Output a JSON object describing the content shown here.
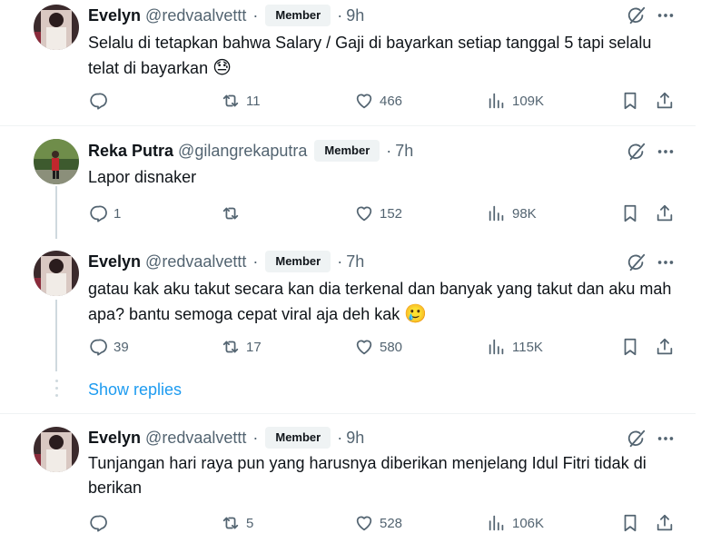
{
  "tweets": [
    {
      "name": "Evelyn",
      "handle": "@redvaalvettt",
      "badge": "Member",
      "dot": "·",
      "time": "9h",
      "text": "Selalu di tetapkan bahwa Salary / Gaji di bayarkan setiap tanggal 5 tapi selalu telat di bayarkan",
      "emoji": "😓",
      "replies": "",
      "reposts": "11",
      "likes": "466",
      "views": "109K"
    },
    {
      "name": "Reka Putra",
      "handle": "@gilangrekaputra",
      "badge": "Member",
      "dot": "·",
      "time": "7h",
      "text": "Lapor disnaker",
      "emoji": "",
      "replies": "1",
      "reposts": "",
      "likes": "152",
      "views": "98K"
    },
    {
      "name": "Evelyn",
      "handle": "@redvaalvettt",
      "badge": "Member",
      "dot": "·",
      "time": "7h",
      "text": "gatau kak aku takut secara kan dia terkenal dan banyak yang takut dan aku mah apa? bantu semoga cepat viral aja deh kak",
      "emoji": "🥲",
      "replies": "39",
      "reposts": "17",
      "likes": "580",
      "views": "115K"
    },
    {
      "name": "Evelyn",
      "handle": "@redvaalvettt",
      "badge": "Member",
      "dot": "·",
      "time": "9h",
      "text": "Tunjangan hari raya pun yang harusnya diberikan menjelang Idul Fitri tidak di berikan",
      "emoji": "",
      "replies": "",
      "reposts": "5",
      "likes": "528",
      "views": "106K"
    }
  ],
  "show_replies_label": "Show replies",
  "colors": {
    "text": "#0f1419",
    "secondary": "#536471",
    "link": "#1d9bf0",
    "badge_bg": "#eff3f4",
    "thread_line": "#cfd9de"
  },
  "icons": [
    "reply-icon",
    "repost-icon",
    "like-icon",
    "views-icon",
    "bookmark-icon",
    "share-icon",
    "grok-icon",
    "more-icon"
  ]
}
